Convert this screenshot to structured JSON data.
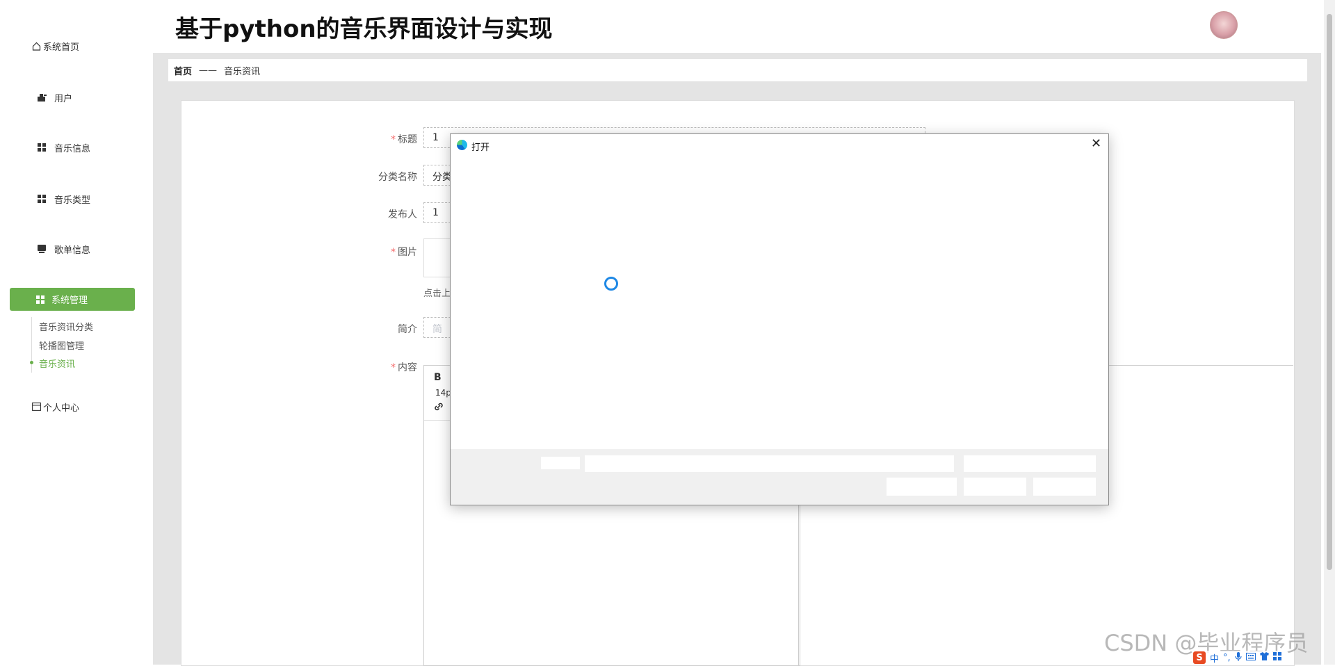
{
  "app": {
    "title": "基于python的音乐界面设计与实现"
  },
  "sidebar": {
    "items": [
      {
        "label": "系统首页",
        "icon": "home-icon"
      },
      {
        "label": "用户",
        "icon": "user-icon"
      },
      {
        "label": "音乐信息",
        "icon": "grid-icon"
      },
      {
        "label": "音乐类型",
        "icon": "grid-icon"
      },
      {
        "label": "歌单信息",
        "icon": "list-icon"
      },
      {
        "label": "系统管理",
        "icon": "grid-icon",
        "active": true
      },
      {
        "label": "个人中心",
        "icon": "card-icon"
      }
    ],
    "submenu": [
      {
        "label": "音乐资讯分类"
      },
      {
        "label": "轮播图管理"
      },
      {
        "label": "音乐资讯",
        "active": true
      }
    ]
  },
  "breadcrumb": {
    "home": "首页",
    "separator": "——",
    "current": "音乐资讯"
  },
  "form": {
    "title_label": "标题",
    "title_value": "1",
    "category_label": "分类名称",
    "category_value": "分类",
    "publisher_label": "发布人",
    "publisher_value": "1",
    "image_label": "图片",
    "upload_tip": "点击上",
    "intro_label": "简介",
    "intro_placeholder": "简",
    "content_label": "内容",
    "required_mark": "*",
    "editor_bold": "B",
    "editor_font_size": "14p",
    "editor_link_icon": "🔗"
  },
  "dialog": {
    "title": "打开",
    "close": "✕"
  },
  "watermark": "CSDN @毕业程序员",
  "ime": {
    "logo": "S",
    "lang": "中",
    "punct": "°,"
  },
  "colors": {
    "accent": "#6ab04c",
    "required": "#f56c6c",
    "spinner": "#1e88e5"
  }
}
